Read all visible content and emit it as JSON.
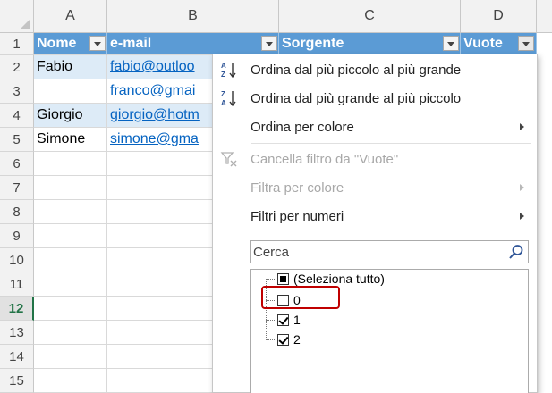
{
  "columns": [
    "A",
    "B",
    "C",
    "D"
  ],
  "rows": [
    "1",
    "2",
    "3",
    "4",
    "5",
    "6",
    "7",
    "8",
    "9",
    "10",
    "11",
    "12",
    "13",
    "14",
    "15"
  ],
  "active_row": "12",
  "table": {
    "headers": [
      "Nome",
      "e-mail",
      "Sorgente",
      "Vuote"
    ],
    "names": [
      "Fabio",
      "",
      "Giorgio",
      "Simone"
    ],
    "emails": [
      "fabio@outloo",
      "franco@gmai",
      "giorgio@hotm",
      "simone@gma"
    ]
  },
  "menu": {
    "sort_asc": "Ordina dal più piccolo al più grande",
    "sort_desc": "Ordina dal più grande al più piccolo",
    "sort_color": "Ordina per colore",
    "clear_filter": "Cancella filtro da \"Vuote\"",
    "filter_color": "Filtra per colore",
    "number_filters": "Filtri per numeri",
    "search_placeholder": "Cerca",
    "items": {
      "select_all": "(Seleziona tutto)",
      "v0": "0",
      "v1": "1",
      "v2": "2"
    }
  },
  "colors": {
    "header_fill": "#5b9bd5",
    "band_fill": "#ddebf7",
    "link": "#0563c1",
    "highlight_box": "#c00000",
    "active_row": "#217346"
  }
}
